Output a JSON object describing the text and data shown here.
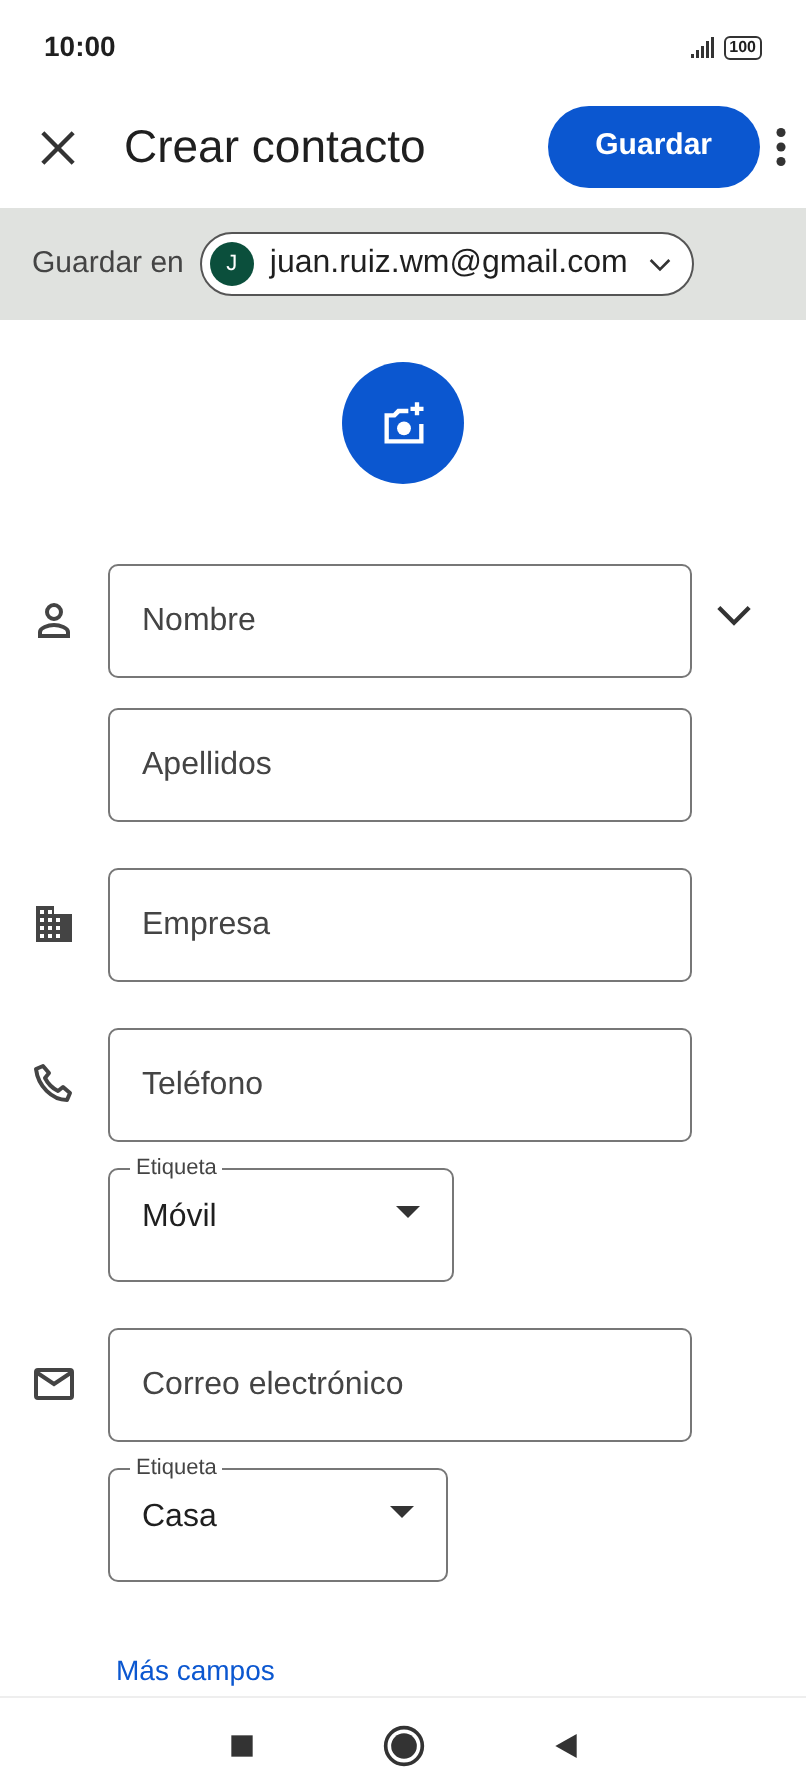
{
  "status_bar": {
    "time": "10:00",
    "battery": "100"
  },
  "app_bar": {
    "title": "Crear contacto",
    "save_button": "Guardar"
  },
  "account": {
    "label": "Guardar en",
    "avatar_letter": "J",
    "email": "juan.ruiz.wm@gmail.com"
  },
  "groups": [
    {
      "kind": "name",
      "fields": [
        {
          "kind": "text",
          "placeholder": "Nombre"
        },
        {
          "kind": "text",
          "placeholder": "Apellidos"
        }
      ]
    },
    {
      "kind": "company",
      "fields": [
        {
          "kind": "text",
          "placeholder": "Empresa"
        }
      ]
    },
    {
      "kind": "phone",
      "fields": [
        {
          "kind": "text",
          "placeholder": "Teléfono"
        },
        {
          "kind": "select",
          "label": "Etiqueta",
          "value": "Móvil"
        }
      ]
    },
    {
      "kind": "email",
      "fields": [
        {
          "kind": "text",
          "placeholder": "Correo electrónico"
        },
        {
          "kind": "select",
          "label": "Etiqueta",
          "value": "Casa"
        }
      ]
    }
  ],
  "more_link": "Más campos"
}
